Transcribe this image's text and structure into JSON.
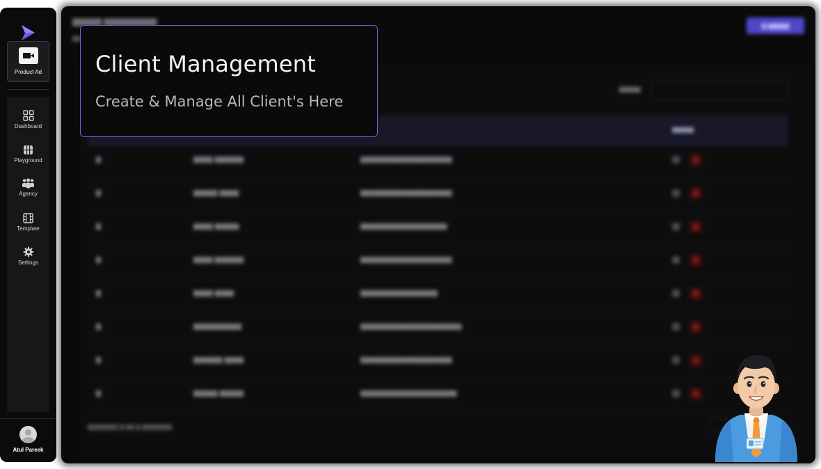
{
  "sidebar": {
    "logo_icon": "play-triangle-logo-icon",
    "product": {
      "label": "Product Ad",
      "icon": "video-camera-icon"
    },
    "items": [
      {
        "label": "Dashboard",
        "icon": "dashboard-grid-icon"
      },
      {
        "label": "Playground",
        "icon": "playground-icon"
      },
      {
        "label": "Agency",
        "icon": "team-icon"
      },
      {
        "label": "Template",
        "icon": "film-icon"
      },
      {
        "label": "Settings",
        "icon": "gear-icon"
      }
    ],
    "user": {
      "name": "Atul Pareek"
    }
  },
  "callout": {
    "title": "Client Management",
    "subtitle": "Create & Manage All Client's Here",
    "border_color": "#6d5fd9"
  },
  "main": {
    "accent_color": "#4f46c9"
  }
}
